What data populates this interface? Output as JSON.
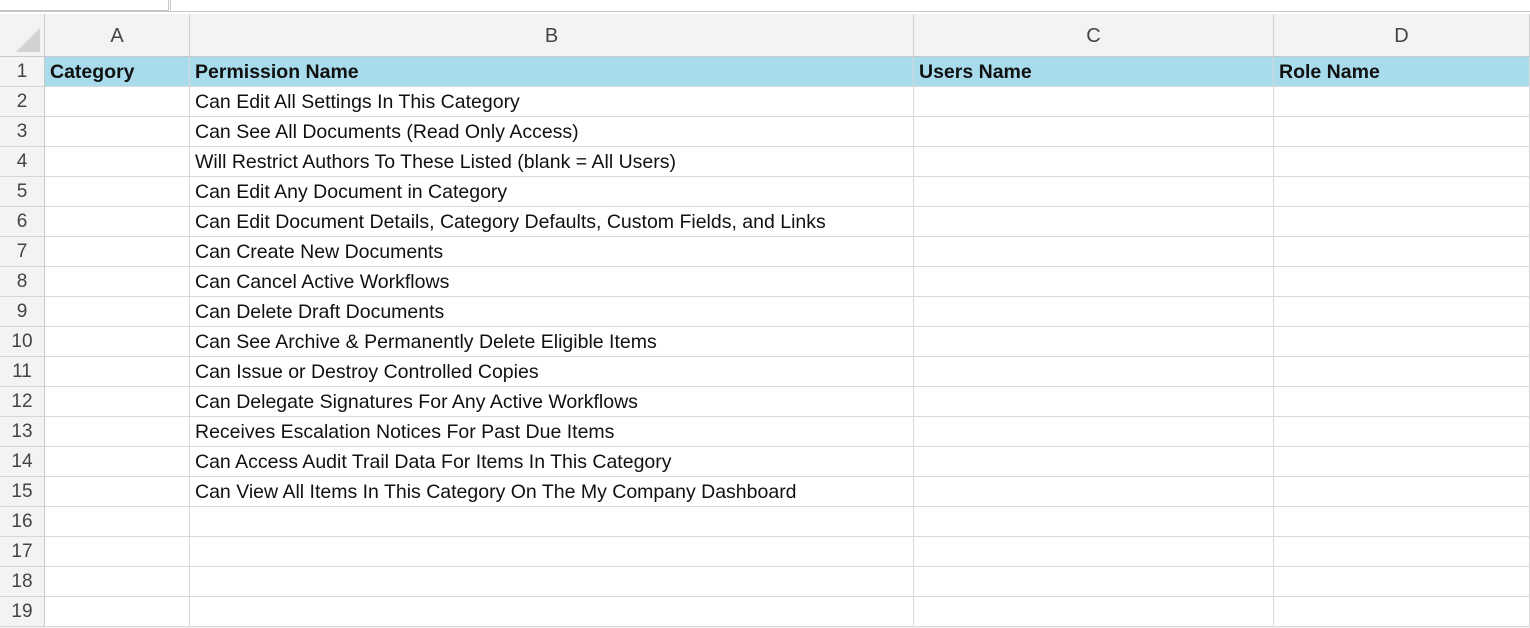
{
  "columns": [
    "A",
    "B",
    "C",
    "D"
  ],
  "rows": [
    "1",
    "2",
    "3",
    "4",
    "5",
    "6",
    "7",
    "8",
    "9",
    "10",
    "11",
    "12",
    "13",
    "14",
    "15",
    "16",
    "17",
    "18",
    "19"
  ],
  "header_fill": "#a8dcec",
  "headers": {
    "category": "Category",
    "permission_name": "Permission Name",
    "users_name": "Users Name",
    "role_name": "Role Name"
  },
  "permissions": [
    "Can Edit All Settings In This Category",
    "Can See All Documents (Read Only Access)",
    "Will Restrict Authors To These Listed (blank = All Users)",
    "Can Edit Any Document in Category",
    "Can Edit Document Details, Category Defaults, Custom Fields, and Links",
    "Can Create New Documents",
    "Can Cancel Active Workflows",
    "Can Delete Draft Documents",
    "Can See Archive & Permanently Delete Eligible Items",
    "Can Issue or Destroy Controlled Copies",
    "Can Delegate Signatures For Any Active Workflows",
    "Receives Escalation Notices For Past Due Items",
    "Can Access Audit Trail Data For Items In This Category",
    "Can View All Items In This Category On The My Company Dashboard"
  ]
}
